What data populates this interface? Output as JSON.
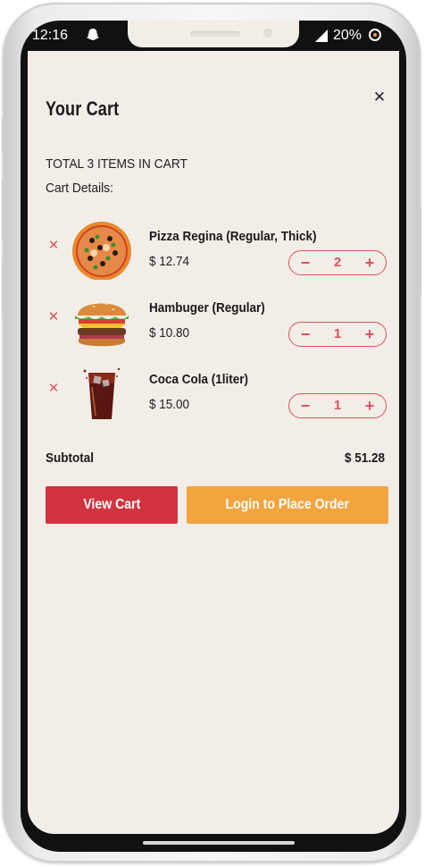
{
  "status_bar": {
    "time": "12:16",
    "battery": "20%",
    "icons": [
      "snapchat-icon",
      "signal-icon",
      "battery-icon"
    ]
  },
  "cart": {
    "title": "Your Cart",
    "total_text": "TOTAL 3 ITEMS IN CART",
    "details_label": "Cart Details:",
    "items": [
      {
        "name": "Pizza Regina (Regular, Thick)",
        "price": "$ 12.74",
        "quantity": "2",
        "image": "pizza-image"
      },
      {
        "name": "Hambuger (Regular)",
        "price": "$ 10.80",
        "quantity": "1",
        "image": "burger-image"
      },
      {
        "name": "Coca Cola (1liter)",
        "price": "$ 15.00",
        "quantity": "1",
        "image": "cola-image"
      }
    ],
    "subtotal_label": "Subtotal",
    "subtotal_value": "$ 51.28",
    "view_cart_label": "View Cart",
    "login_label": "Login to Place Order"
  },
  "colors": {
    "accent_red": "#d2343f",
    "accent_orange": "#f2a43f",
    "background": "#f2ede7"
  }
}
